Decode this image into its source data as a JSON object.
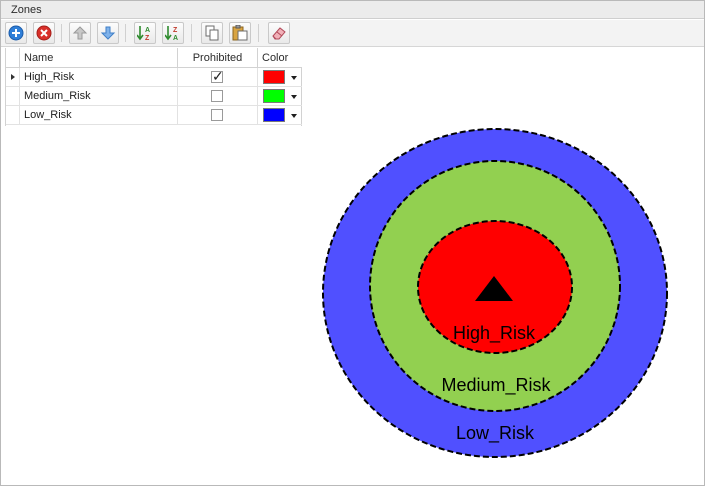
{
  "panel": {
    "title": "Zones"
  },
  "toolbar": {
    "buttons": [
      {
        "name": "add-zone-button",
        "icon": "plus-circle-icon"
      },
      {
        "name": "delete-zone-button",
        "icon": "remove-circle-icon"
      },
      {
        "name": "move-up-button",
        "icon": "arrow-up-icon"
      },
      {
        "name": "move-down-button",
        "icon": "arrow-down-icon"
      },
      {
        "name": "sort-ascending-button",
        "icon": "sort-az-icon"
      },
      {
        "name": "sort-descending-button",
        "icon": "sort-za-icon"
      },
      {
        "name": "copy-button",
        "icon": "copy-icon"
      },
      {
        "name": "paste-button",
        "icon": "paste-icon"
      },
      {
        "name": "eraser-button",
        "icon": "eraser-icon"
      }
    ]
  },
  "grid": {
    "columns": {
      "name": "Name",
      "prohibited": "Prohibited",
      "color": "Color"
    },
    "rows": [
      {
        "name": "High_Risk",
        "prohibited": true,
        "color": "#ff0000",
        "selected": true
      },
      {
        "name": "Medium_Risk",
        "prohibited": false,
        "color": "#00ff00",
        "selected": false
      },
      {
        "name": "Low_Risk",
        "prohibited": false,
        "color": "#0000ff",
        "selected": false
      }
    ]
  },
  "diagram": {
    "zones": [
      {
        "label": "Low_Risk",
        "fill": "#5050ff"
      },
      {
        "label": "Medium_Risk",
        "fill": "#92d050"
      },
      {
        "label": "High_Risk",
        "fill": "#ff0000"
      }
    ],
    "marker_icon": "triangle-marker-icon"
  }
}
